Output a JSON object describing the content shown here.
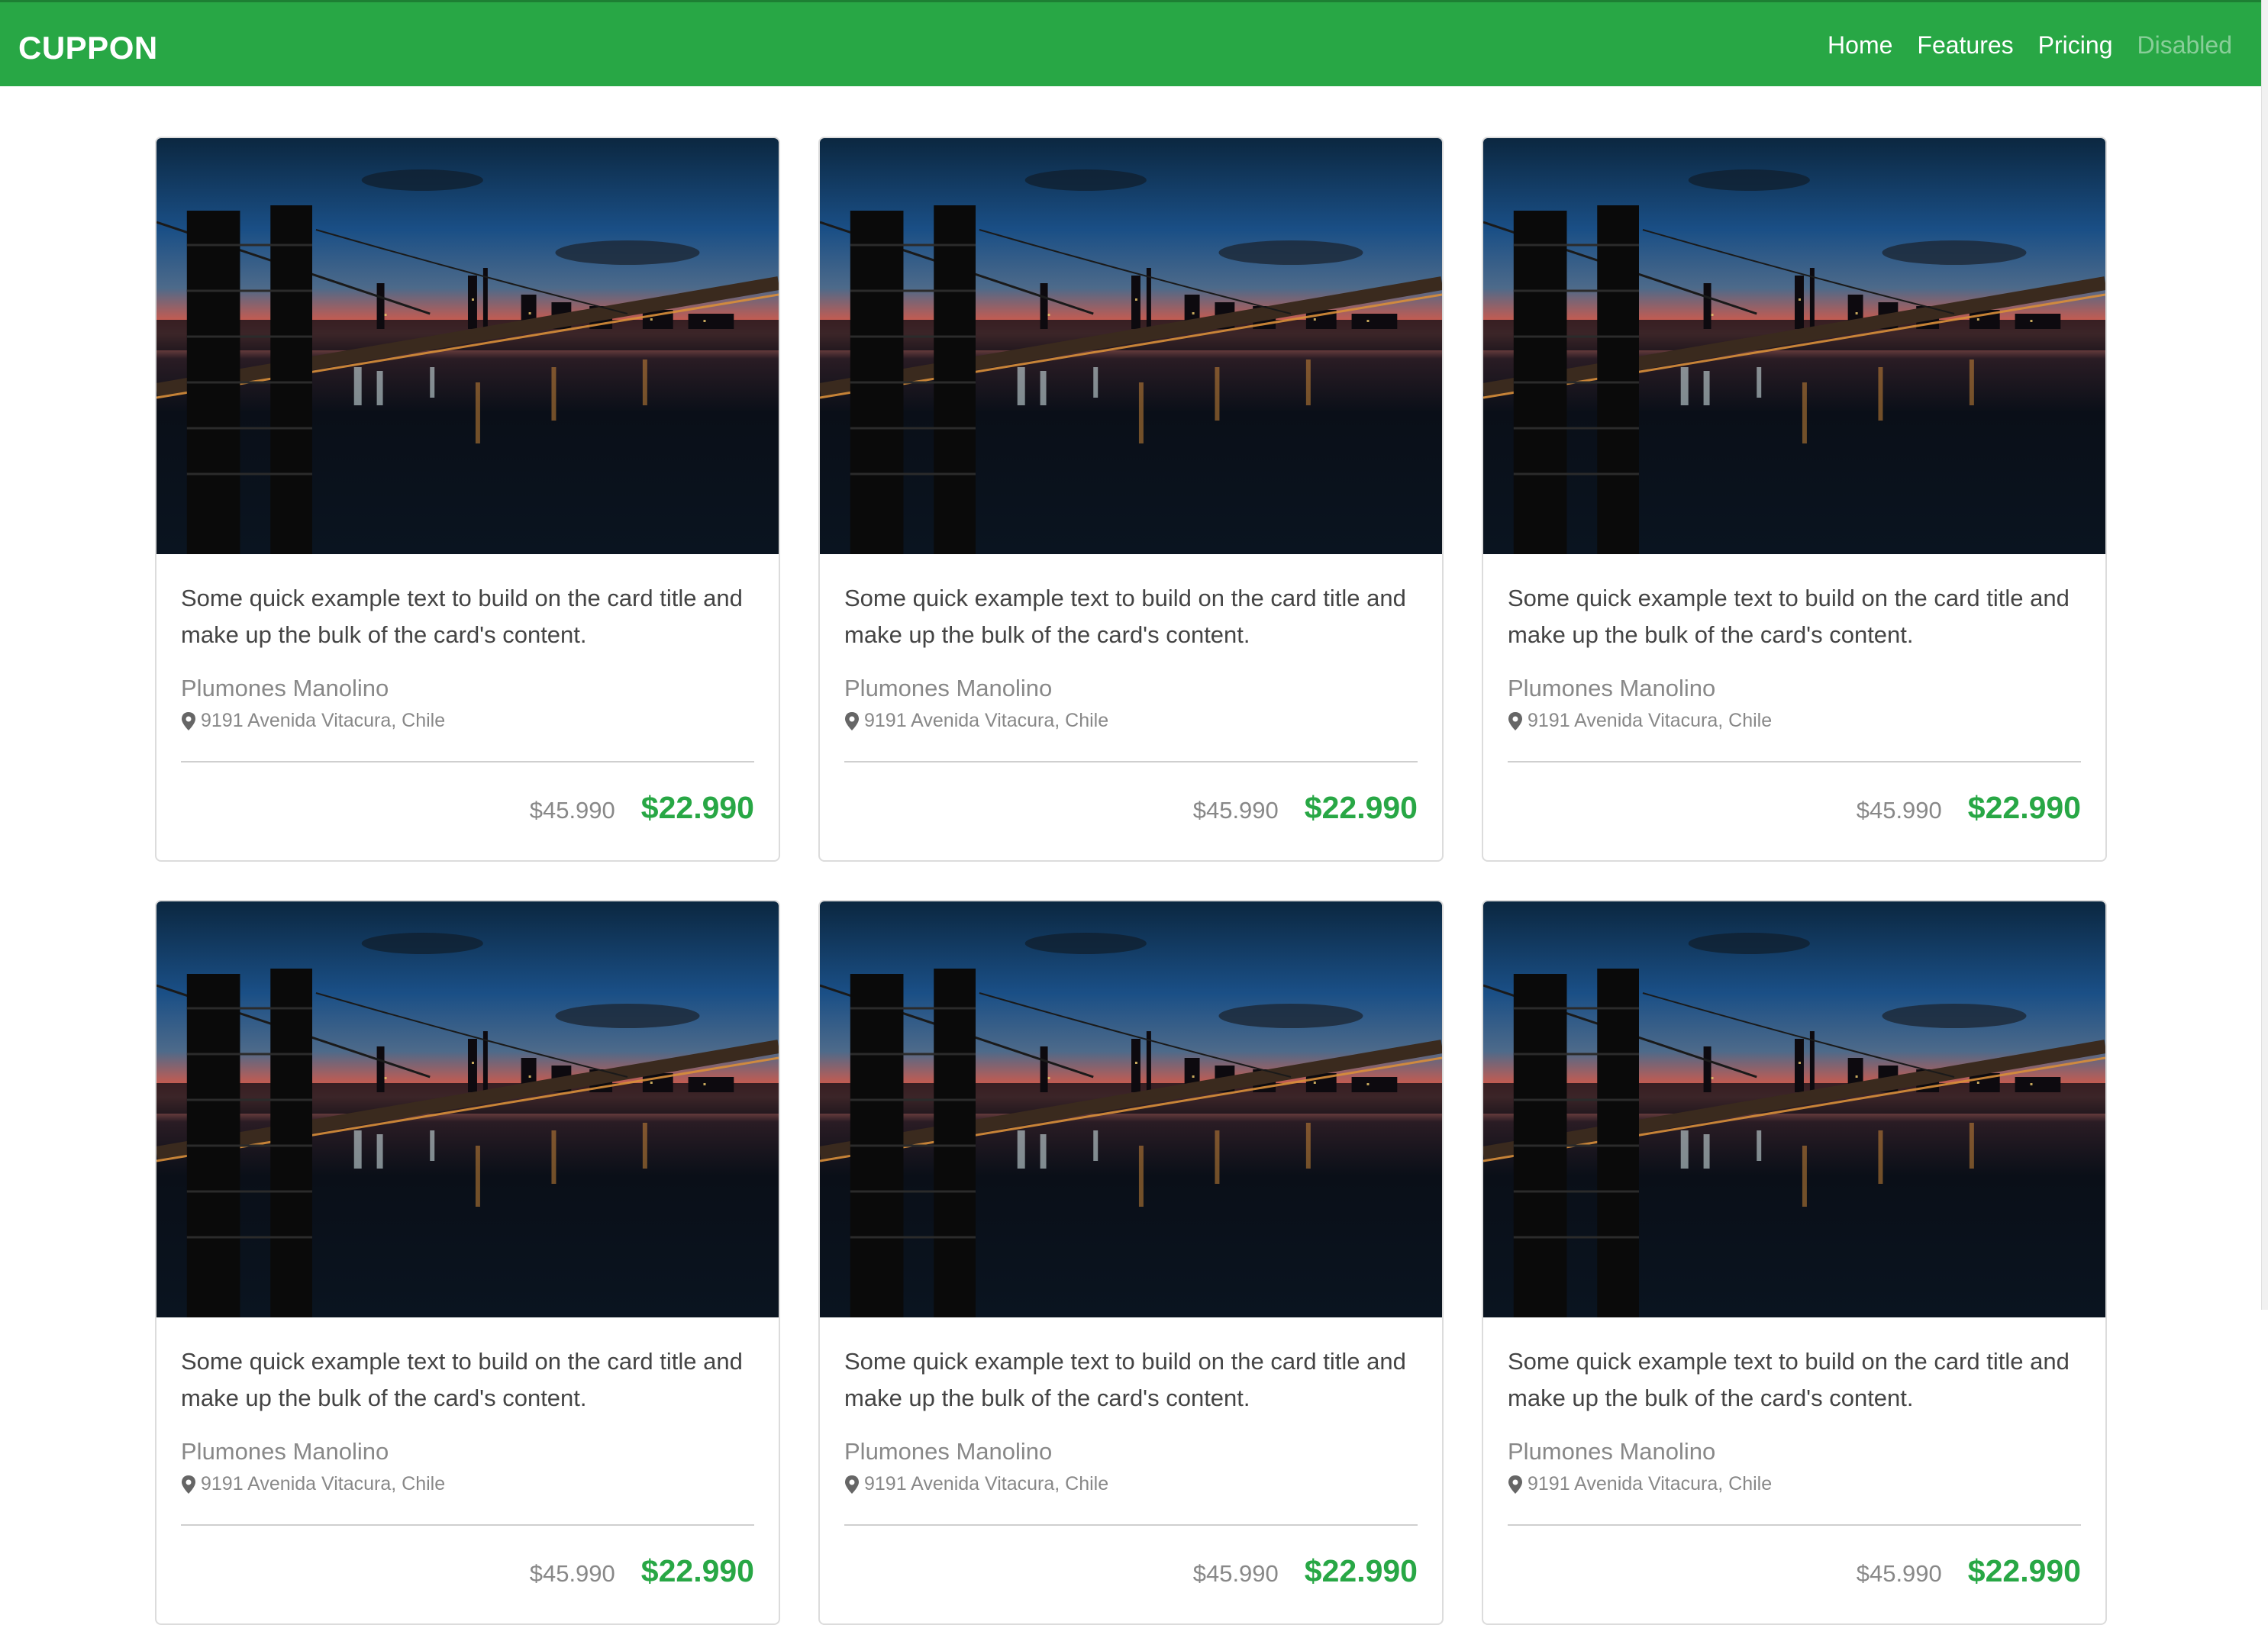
{
  "navbar": {
    "brand": "CUPPON",
    "links": [
      {
        "label": "Home",
        "disabled": false
      },
      {
        "label": "Features",
        "disabled": false
      },
      {
        "label": "Pricing",
        "disabled": false
      },
      {
        "label": "Disabled",
        "disabled": true
      }
    ]
  },
  "theme": {
    "accent": "#28a745"
  },
  "cards": [
    {
      "text": "Some quick example text to build on the card title and make up the bulk of the card's content.",
      "name": "Plumones Manolino",
      "address": "9191 Avenida Vitacura, Chile",
      "old_price": "$45.990",
      "new_price": "$22.990"
    },
    {
      "text": "Some quick example text to build on the card title and make up the bulk of the card's content.",
      "name": "Plumones Manolino",
      "address": "9191 Avenida Vitacura, Chile",
      "old_price": "$45.990",
      "new_price": "$22.990"
    },
    {
      "text": "Some quick example text to build on the card title and make up the bulk of the card's content.",
      "name": "Plumones Manolino",
      "address": "9191 Avenida Vitacura, Chile",
      "old_price": "$45.990",
      "new_price": "$22.990"
    },
    {
      "text": "Some quick example text to build on the card title and make up the bulk of the card's content.",
      "name": "Plumones Manolino",
      "address": "9191 Avenida Vitacura, Chile",
      "old_price": "$45.990",
      "new_price": "$22.990"
    },
    {
      "text": "Some quick example text to build on the card title and make up the bulk of the card's content.",
      "name": "Plumones Manolino",
      "address": "9191 Avenida Vitacura, Chile",
      "old_price": "$45.990",
      "new_price": "$22.990"
    },
    {
      "text": "Some quick example text to build on the card title and make up the bulk of the card's content.",
      "name": "Plumones Manolino",
      "address": "9191 Avenida Vitacura, Chile",
      "old_price": "$45.990",
      "new_price": "$22.990"
    }
  ],
  "icons": {
    "location": "map-marker-icon"
  }
}
